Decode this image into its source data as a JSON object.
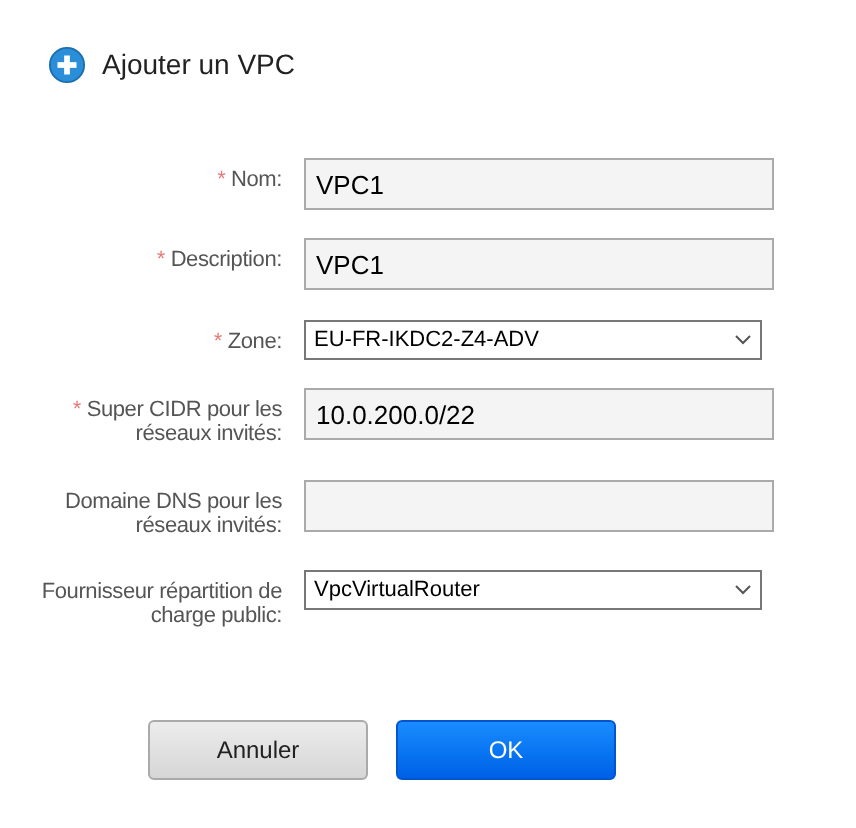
{
  "title": "Ajouter un VPC",
  "fields": [
    {
      "label": "Nom:",
      "required_mark": "*",
      "kind": "text",
      "value": "VPC1"
    },
    {
      "label": "Description:",
      "required_mark": "*",
      "kind": "text",
      "value": "VPC1"
    },
    {
      "label": "Zone:",
      "required_mark": "*",
      "kind": "select",
      "value": "EU-FR-IKDC2-Z4-ADV"
    },
    {
      "label": "Super CIDR pour les réseaux invités:",
      "required_mark": "*",
      "kind": "text",
      "value": "10.0.200.0/22"
    },
    {
      "label": "Domaine DNS pour les réseaux invités:",
      "kind": "text"
    },
    {
      "label": "Fournisseur répartition de charge public:",
      "kind": "select",
      "value": "VpcVirtualRouter"
    }
  ],
  "buttons": [
    {
      "label": "Annuler",
      "kind": "secondary"
    },
    {
      "label": "OK",
      "kind": "primary"
    }
  ]
}
